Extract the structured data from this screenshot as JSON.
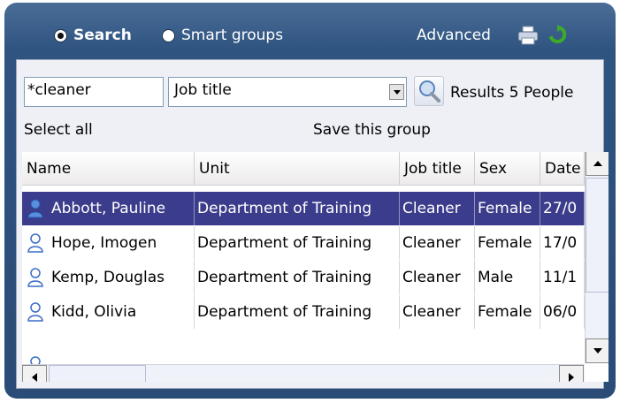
{
  "search_mode": {
    "search_label": "Search",
    "smart_groups_label": "Smart groups",
    "selected": "search"
  },
  "toolbar": {
    "advanced_label": "Advanced"
  },
  "query": {
    "text_value": "*cleaner",
    "field_selected": "Job title"
  },
  "results": {
    "label": "Results 5 People"
  },
  "actions": {
    "select_all": "Select all",
    "save_group": "Save this group"
  },
  "table": {
    "columns": [
      "Name",
      "Unit",
      "Job title",
      "Sex",
      "Date"
    ],
    "rows": [
      {
        "name": "Abbott, Pauline",
        "unit": "Department of Training",
        "job": "Cleaner",
        "sex": "Female",
        "date": "27/0"
      },
      {
        "name": "Hope, Imogen",
        "unit": "Department of Training",
        "job": "Cleaner",
        "sex": "Female",
        "date": "17/0"
      },
      {
        "name": "Kemp, Douglas",
        "unit": "Department of Training",
        "job": "Cleaner",
        "sex": "Male",
        "date": "11/1"
      },
      {
        "name": "Kidd, Olivia",
        "unit": "Department of Training",
        "job": "Cleaner",
        "sex": "Female",
        "date": "06/0"
      }
    ],
    "selected_row": 0
  },
  "colors": {
    "selection": "#3c3c8c",
    "panel": "#2f5480",
    "print_icon": "#5b7aa3",
    "refresh_icon": "#3daa2a"
  },
  "icons": [
    "print-icon",
    "refresh-icon",
    "search-icon",
    "person-icon",
    "chevron-down-icon"
  ]
}
